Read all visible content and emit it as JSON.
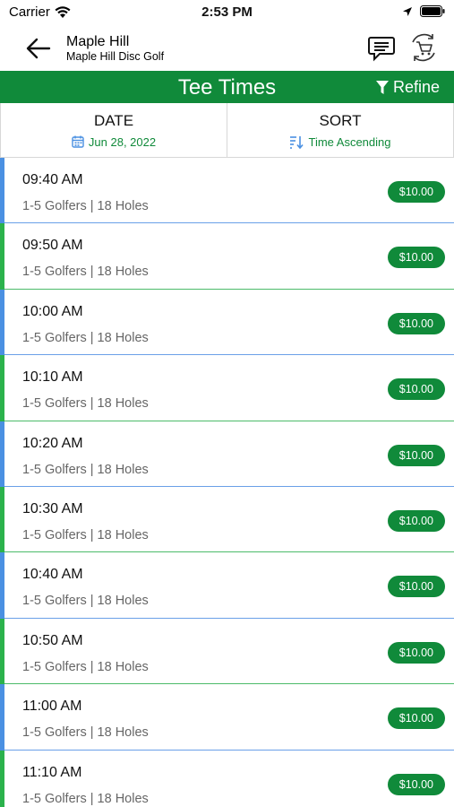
{
  "status_bar": {
    "carrier": "Carrier",
    "time": "2:53 PM"
  },
  "header": {
    "title": "Maple Hill",
    "subtitle": "Maple Hill Disc Golf"
  },
  "banner": {
    "title": "Tee Times",
    "refine_label": "Refine"
  },
  "filters": {
    "date": {
      "label": "DATE",
      "value": "Jun 28, 2022"
    },
    "sort": {
      "label": "SORT",
      "value": "Time Ascending"
    }
  },
  "colors": {
    "brand_green": "#108a3a",
    "accent_blue": "#4a90e2",
    "accent_green": "#2bb24c"
  },
  "tee_times": [
    {
      "time": "09:40 AM",
      "details": "1-5 Golfers | 18 Holes",
      "price": "$10.00",
      "accent": "blue"
    },
    {
      "time": "09:50 AM",
      "details": "1-5 Golfers | 18 Holes",
      "price": "$10.00",
      "accent": "green"
    },
    {
      "time": "10:00 AM",
      "details": "1-5 Golfers | 18 Holes",
      "price": "$10.00",
      "accent": "blue"
    },
    {
      "time": "10:10 AM",
      "details": "1-5 Golfers | 18 Holes",
      "price": "$10.00",
      "accent": "green"
    },
    {
      "time": "10:20 AM",
      "details": "1-5 Golfers | 18 Holes",
      "price": "$10.00",
      "accent": "blue"
    },
    {
      "time": "10:30 AM",
      "details": "1-5 Golfers | 18 Holes",
      "price": "$10.00",
      "accent": "green"
    },
    {
      "time": "10:40 AM",
      "details": "1-5 Golfers | 18 Holes",
      "price": "$10.00",
      "accent": "blue"
    },
    {
      "time": "10:50 AM",
      "details": "1-5 Golfers | 18 Holes",
      "price": "$10.00",
      "accent": "green"
    },
    {
      "time": "11:00 AM",
      "details": "1-5 Golfers | 18 Holes",
      "price": "$10.00",
      "accent": "blue"
    },
    {
      "time": "11:10 AM",
      "details": "1-5 Golfers | 18 Holes",
      "price": "$10.00",
      "accent": "green"
    }
  ]
}
